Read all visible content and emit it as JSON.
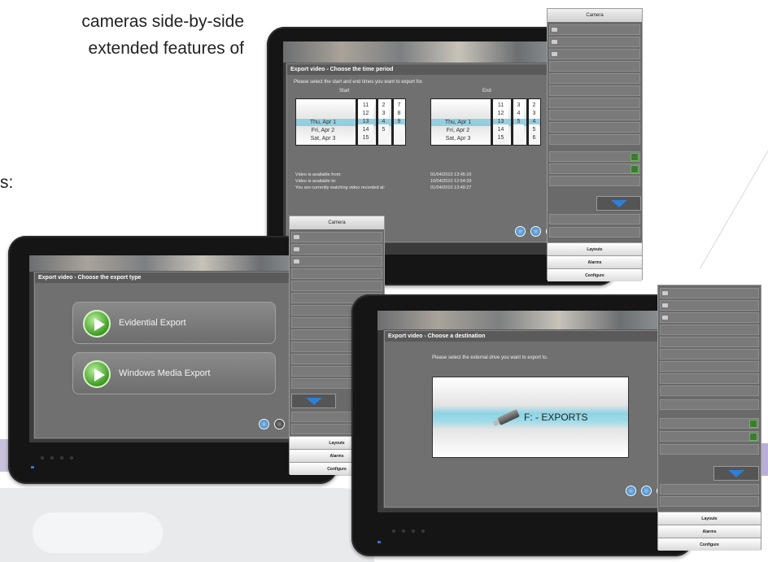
{
  "brochure": {
    "line1": "cameras side-by-side",
    "line2": "extended features of",
    "line3": "s:"
  },
  "monitor_top": {
    "dialog_title": "Export video - Choose the time period",
    "instruction": "Please select the start and end times you want to export for.",
    "start_label": "Start",
    "end_label": "End",
    "start_picker": {
      "days": [
        "Thu, Apr 1",
        "Fri, Apr 2",
        "Sat, Apr 3"
      ],
      "hours": [
        "11",
        "12",
        "13",
        "14",
        "15"
      ],
      "minutes": [
        "2",
        "3",
        "4",
        "5"
      ],
      "seconds": [
        "7",
        "8",
        "9"
      ]
    },
    "end_picker": {
      "days": [
        "Thu, Apr 1",
        "Fri, Apr 2",
        "Sat, Apr 3"
      ],
      "hours": [
        "11",
        "12",
        "13",
        "14",
        "15"
      ],
      "minutes": [
        "3",
        "4",
        "5"
      ],
      "seconds": [
        "2",
        "3",
        "4",
        "5",
        "6"
      ]
    },
    "info": [
      {
        "label": "Video is available from:",
        "value": "01/04/2010 13:45:10"
      },
      {
        "label": "Video is available to:",
        "value": "10/04/2010 12:54:33"
      },
      {
        "label": "You are currently watching video recorded at:",
        "value": "01/04/2010 13:49:27"
      }
    ],
    "side_panel": {
      "header": "Camera",
      "buttons": [
        "Layouts",
        "Alarms",
        "Configure"
      ]
    }
  },
  "monitor_left": {
    "dialog_title": "Export video - Choose the export type",
    "options": [
      "Evidential Export",
      "Windows Media Export"
    ],
    "side_panel": {
      "header": "Camera",
      "buttons": [
        "Layouts",
        "Alarms",
        "Configure"
      ]
    }
  },
  "monitor_right": {
    "dialog_title": "Export video - Choose a destination",
    "instruction": "Please select the external drive you want to export to.",
    "drive_label": "F: - EXPORTS",
    "side_panel": {
      "buttons": [
        "Layouts",
        "Alarms",
        "Configure"
      ]
    }
  },
  "colors": {
    "selection": "#82c8dc",
    "blue_arrow": "#2e7fd8",
    "panel_grey": "#6a6a6a",
    "accent_purple": "#b8aed6"
  }
}
